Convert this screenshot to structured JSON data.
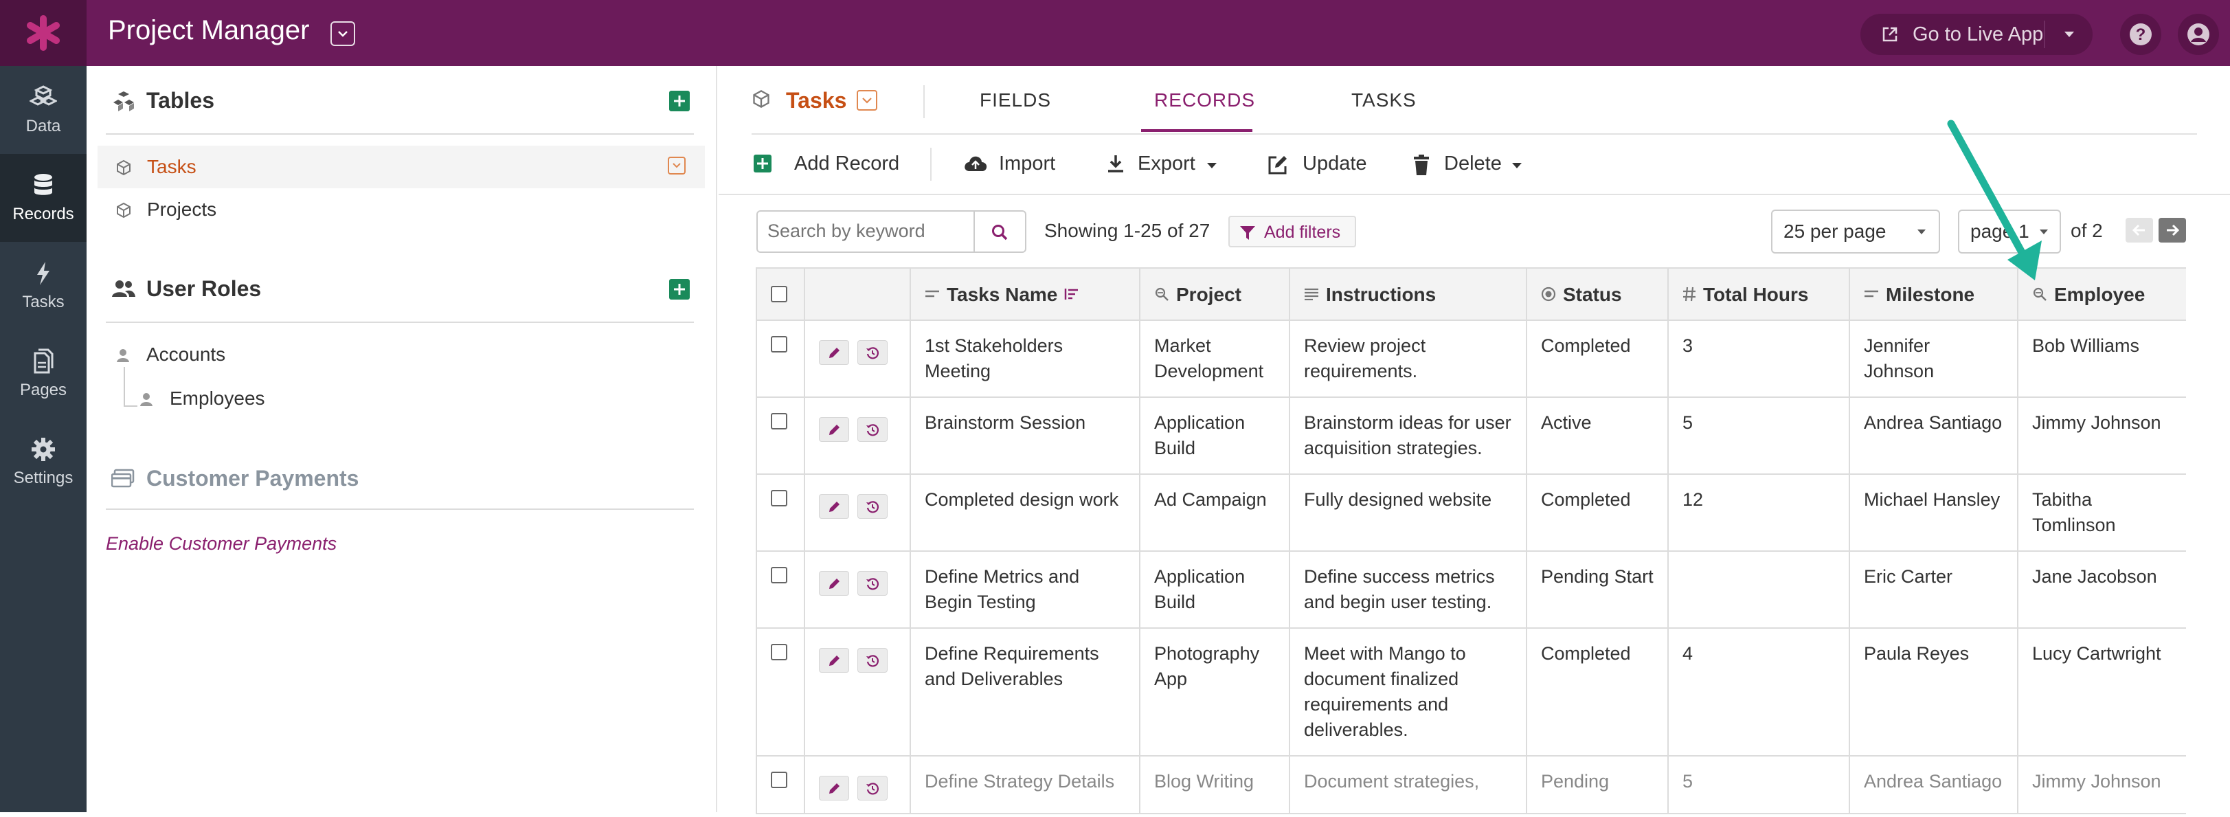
{
  "app": {
    "title": "Project Manager",
    "live_label": "Go to Live App"
  },
  "nav": [
    {
      "label": "Data",
      "icon": "data-cubes-icon"
    },
    {
      "label": "Records",
      "icon": "database-icon"
    },
    {
      "label": "Tasks",
      "icon": "lightning-icon"
    },
    {
      "label": "Pages",
      "icon": "pages-icon"
    },
    {
      "label": "Settings",
      "icon": "gear-icon"
    }
  ],
  "left_panel": {
    "tables_title": "Tables",
    "tables": [
      {
        "label": "Tasks"
      },
      {
        "label": "Projects"
      }
    ],
    "roles_title": "User Roles",
    "roles": [
      {
        "label": "Accounts"
      },
      {
        "label": "Employees"
      }
    ],
    "payments_title": "Customer Payments",
    "payments_link": "Enable Customer Payments"
  },
  "header": {
    "table_title": "Tasks",
    "tabs": [
      {
        "label": "FIELDS"
      },
      {
        "label": "RECORDS"
      },
      {
        "label": "TASKS"
      }
    ],
    "active_tab": "RECORDS"
  },
  "toolbar": {
    "add": "Add Record",
    "import": "Import",
    "export": "Export",
    "update": "Update",
    "delete": "Delete"
  },
  "filters": {
    "search_placeholder": "Search by keyword",
    "showing": "Showing 1-25 of 27",
    "add_filters": "Add filters",
    "per_page": "25 per page",
    "page": "page 1",
    "of_pages": "of 2"
  },
  "grid": {
    "columns": [
      {
        "label": "Tasks Name",
        "icon": "short-text-icon"
      },
      {
        "label": "Project",
        "icon": "connection-icon"
      },
      {
        "label": "Instructions",
        "icon": "paragraph-icon"
      },
      {
        "label": "Status",
        "icon": "radio-icon"
      },
      {
        "label": "Total Hours",
        "icon": "number-icon"
      },
      {
        "label": "Milestone",
        "icon": "short-text-icon"
      },
      {
        "label": "Employee",
        "icon": "connection-icon"
      }
    ],
    "rows": [
      {
        "name": "1st Stakeholders Meeting",
        "project": "Market Development",
        "instructions": "Review project requirements.",
        "status": "Completed",
        "hours": "3",
        "milestone": "Jennifer Johnson",
        "employee": "Bob Williams"
      },
      {
        "name": "Brainstorm Session",
        "project": "Application Build",
        "instructions": "Brainstorm ideas for user acquisition strategies.",
        "status": "Active",
        "hours": "5",
        "milestone": "Andrea Santiago",
        "employee": "Jimmy Johnson"
      },
      {
        "name": "Completed design work",
        "project": "Ad Campaign",
        "instructions": "Fully designed website",
        "status": "Completed",
        "hours": "12",
        "milestone": "Michael Hansley",
        "employee": "Tabitha Tomlinson"
      },
      {
        "name": "Define Metrics and Begin Testing",
        "project": "Application Build",
        "instructions": "Define success metrics and begin user testing.",
        "status": "Pending Start",
        "hours": "",
        "milestone": "Eric Carter",
        "employee": "Jane Jacobson"
      },
      {
        "name": "Define Requirements and Deliverables",
        "project": "Photography App",
        "instructions": "Meet with Mango to document finalized requirements and deliverables.",
        "status": "Completed",
        "hours": "4",
        "milestone": "Paula Reyes",
        "employee": "Lucy Cartwright"
      },
      {
        "name": "Define Strategy Details",
        "project": "Blog Writing",
        "instructions": "Document strategies,",
        "status": "Pending",
        "hours": "5",
        "milestone": "Andrea Santiago",
        "employee": "Jimmy Johnson"
      }
    ]
  },
  "colors": {
    "brand": "#6b1b5a",
    "accent": "#8a1f6e",
    "table_active": "#c64f14",
    "add_green": "#1a8a5a",
    "annotation_arrow": "#1fb39a"
  }
}
